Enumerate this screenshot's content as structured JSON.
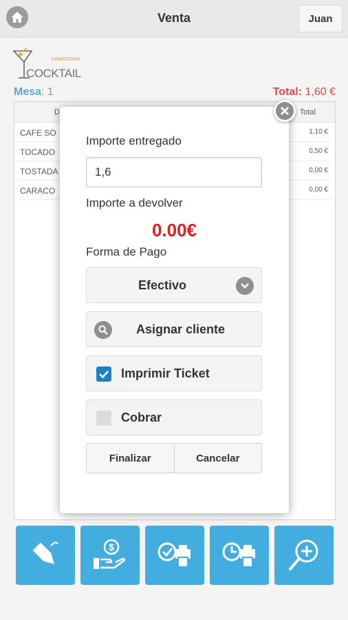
{
  "header": {
    "title": "Venta",
    "user_label": "Juan",
    "home_icon": "home-icon"
  },
  "logo": {
    "small_text": "CONFITERIA",
    "main_text": "COCKTAIL"
  },
  "order": {
    "mesa_label": "Mesa",
    "mesa_value": "1",
    "total_label": "Total:",
    "total_value": "1,60 €"
  },
  "table": {
    "columns": [
      "D",
      "Total"
    ],
    "rows": [
      {
        "desc": "CAFE SO",
        "importe": "1,10 €"
      },
      {
        "desc": "TOCADO",
        "importe": "0,50 €"
      },
      {
        "desc": "TOSTADA",
        "importe": "0,00 €"
      },
      {
        "desc": "CARACO",
        "importe": "0,00 €"
      }
    ]
  },
  "dialog": {
    "amount_label": "Importe entregado",
    "amount_value": "1,6",
    "change_label": "Importe a devolver",
    "change_value": "0.00€",
    "payment_label": "Forma de Pago",
    "payment_method": "Efectivo",
    "assign_client": "Asignar cliente",
    "print_ticket": "Imprimir Ticket",
    "print_ticket_checked": true,
    "cobrar": "Cobrar",
    "cobrar_checked": false,
    "finalize": "Finalizar",
    "cancel": "Cancelar"
  },
  "toolbar": {
    "icons": [
      "price-tag-icon",
      "payment-hand-icon",
      "kitchen-ticket-check-icon",
      "kitchen-ticket-clock-icon",
      "zoom-add-icon"
    ]
  },
  "colors": {
    "accent": "#1a9cd8",
    "total_red": "#e02020",
    "mesa_blue": "#3a93d0",
    "checkbox_blue": "#1e7fc7"
  }
}
